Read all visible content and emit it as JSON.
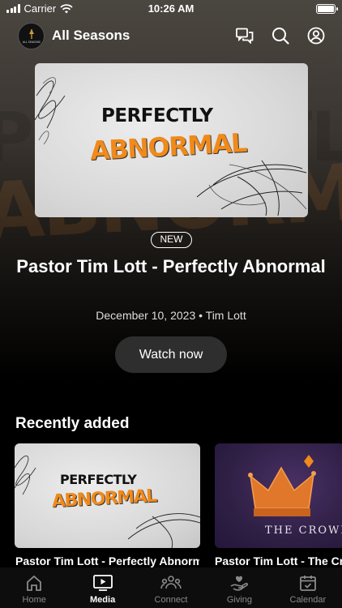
{
  "status_bar": {
    "carrier": "Carrier",
    "time": "10:26 AM"
  },
  "header": {
    "title": "All Seasons",
    "logo_text": "ALL SEASONS"
  },
  "hero": {
    "art_line1": "PERFECTLY",
    "art_line2": "ABNORMAL",
    "badge": "NEW",
    "title": "Pastor Tim Lott - Perfectly Abnormal",
    "meta": "December 10, 2023 • Tim Lott",
    "cta": "Watch now"
  },
  "recently_added": {
    "title": "Recently added",
    "items": [
      {
        "title": "Pastor Tim Lott - Perfectly Abnormal",
        "art_line1": "PERFECTLY",
        "art_line2": "ABNORMAL"
      },
      {
        "title": "Pastor Tim Lott - The Crown",
        "art_text": "THE CROWN"
      }
    ]
  },
  "tabs": [
    {
      "label": "Home",
      "icon": "home-icon"
    },
    {
      "label": "Media",
      "icon": "media-icon",
      "active": true
    },
    {
      "label": "Connect",
      "icon": "connect-icon"
    },
    {
      "label": "Giving",
      "icon": "giving-icon"
    },
    {
      "label": "Calendar",
      "icon": "calendar-icon"
    }
  ],
  "colors": {
    "accent_orange": "#f08a1b",
    "background": "#000000",
    "button": "#2e2e2e"
  }
}
